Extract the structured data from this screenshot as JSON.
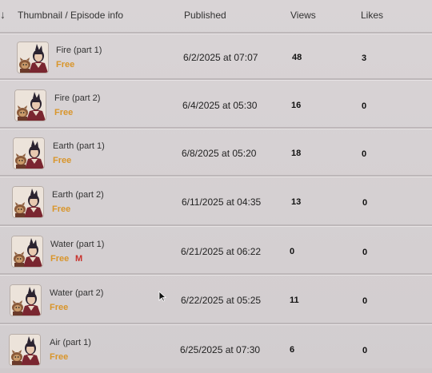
{
  "header": {
    "sort_icon": "↓",
    "col_thumbnail": "Thumbnail / Episode info",
    "col_published": "Published",
    "col_views": "Views",
    "col_likes": "Likes"
  },
  "episodes": [
    {
      "title": "Fire (part 1)",
      "badge": "Free",
      "extra_badge": "",
      "published": "6/2/2025 at 07:07",
      "views": "48",
      "likes": "3"
    },
    {
      "title": "Fire (part 2)",
      "badge": "Free",
      "extra_badge": "",
      "published": "6/4/2025 at 05:30",
      "views": "16",
      "likes": "0"
    },
    {
      "title": "Earth (part 1)",
      "badge": "Free",
      "extra_badge": "",
      "published": "6/8/2025 at 05:20",
      "views": "18",
      "likes": "0"
    },
    {
      "title": "Earth (part 2)",
      "badge": "Free",
      "extra_badge": "",
      "published": "6/11/2025 at 04:35",
      "views": "13",
      "likes": "0"
    },
    {
      "title": "Water (part 1)",
      "badge": "Free",
      "extra_badge": "M",
      "published": "6/21/2025 at 06:22",
      "views": "0",
      "likes": "0"
    },
    {
      "title": "Water (part 2)",
      "badge": "Free",
      "extra_badge": "",
      "published": "6/22/2025 at 05:25",
      "views": "11",
      "likes": "0"
    },
    {
      "title": "Air (part 1)",
      "badge": "Free",
      "extra_badge": "",
      "published": "6/25/2025 at 07:30",
      "views": "6",
      "likes": "0"
    }
  ],
  "colors": {
    "free_badge": "#d9952a",
    "mature_badge": "#c8322d",
    "background": "#d6d1d3"
  },
  "icons": {
    "sort": "sort-arrow-down-icon",
    "thumbnail": "episode-thumbnail",
    "cursor": "mouse-pointer-icon"
  }
}
